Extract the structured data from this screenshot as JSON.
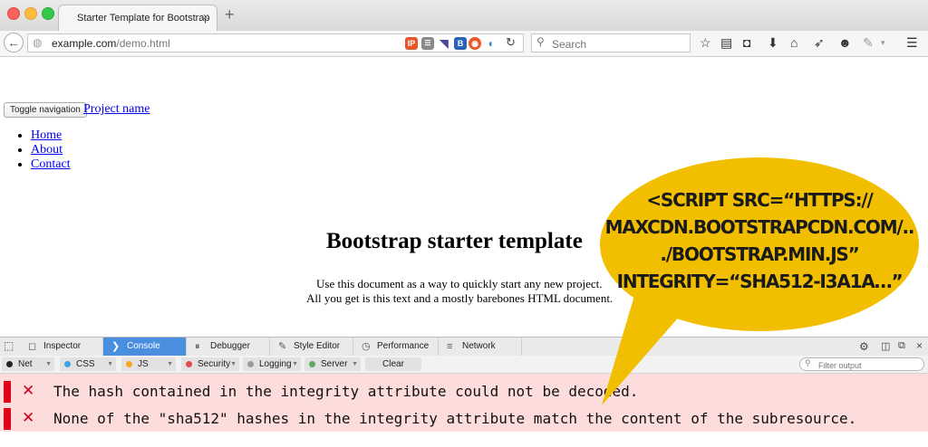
{
  "window": {
    "tab_title": "Starter Template for Bootstrap",
    "tab_close": "×",
    "new_tab": "+"
  },
  "navbar": {
    "url_host": "example.com",
    "url_path": "/demo.html",
    "search_placeholder": "Search",
    "extensions": [
      "IP",
      "B"
    ]
  },
  "page": {
    "toggle_label": "Toggle navigation",
    "brand": "Project name",
    "nav_items": [
      "Home",
      "About",
      "Contact"
    ],
    "heading": "Bootstrap starter template",
    "lead_line1": "Use this document as a way to quickly start any new project.",
    "lead_line2": "All you get is this text and a mostly barebones HTML document."
  },
  "devtools": {
    "tabs": [
      "Inspector",
      "Console",
      "Debugger",
      "Style Editor",
      "Performance",
      "Network"
    ],
    "active_tab": "Console",
    "filters": [
      {
        "label": "Net",
        "color": "#222222"
      },
      {
        "label": "CSS",
        "color": "#3aa3e3"
      },
      {
        "label": "JS",
        "color": "#f5a623"
      },
      {
        "label": "Security",
        "color": "#e34c4c"
      },
      {
        "label": "Logging",
        "color": "#9b9b9b"
      },
      {
        "label": "Server",
        "color": "#5fa85f"
      }
    ],
    "clear_label": "Clear",
    "filter_placeholder": "Filter output",
    "messages": [
      "The hash contained in the integrity attribute could not be decoded.",
      "None of the \"sha512\" hashes in the integrity attribute match the content of the subresource."
    ],
    "error_glyph": "✕"
  },
  "callout": {
    "lines": [
      "<SCRIPT SRC=“HTTPS://",
      "MAXCDN.BOOTSTRAPCDN.COM/..",
      "./BOOTSTRAP.MIN.JS”",
      "INTEGRITY=“SHA512-I3A1A…”"
    ],
    "color": "#f2bf00"
  }
}
